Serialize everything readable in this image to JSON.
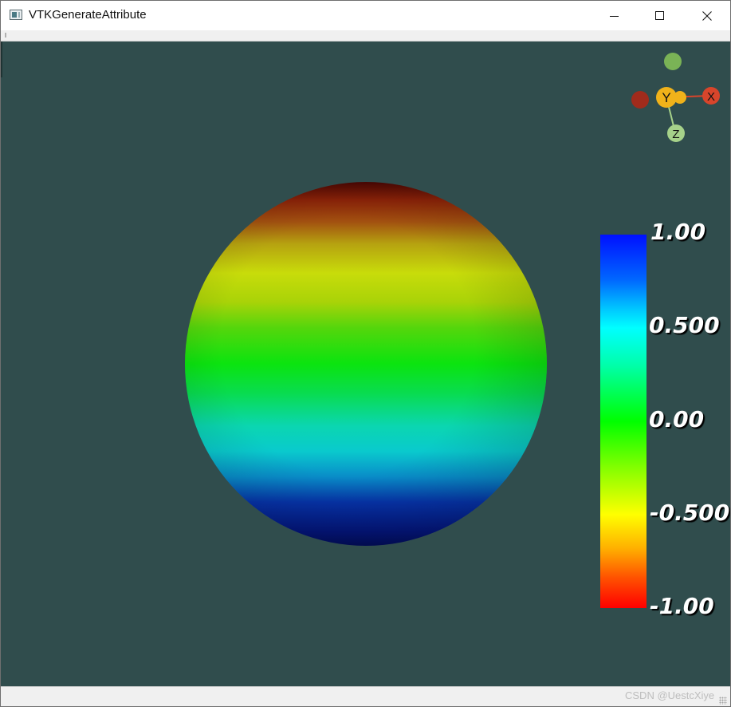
{
  "window": {
    "title": "VTKGenerateAttribute",
    "icon": "app-window-icon",
    "controls": [
      "minimize-icon",
      "maximize-icon",
      "close-icon"
    ]
  },
  "viewport": {
    "background_color": "#304d4d",
    "object": "sphere",
    "colormap": "rainbow (red to blue)"
  },
  "scalar_bar": {
    "tick_labels": [
      "1.00",
      "0.500",
      "0.00",
      "-0.500",
      "-1.00"
    ],
    "range": [
      -1.0,
      1.0
    ],
    "color_low": "#ff0000",
    "color_high": "#0010ff"
  },
  "orientation_axes": {
    "x_label": "X",
    "y_label": "Y",
    "z_label": "Z",
    "x_color": "#d8452b",
    "y_color": "#f0b21a",
    "z_color": "#a6d28a"
  },
  "statusbar": {
    "watermark": "CSDN @UestcXiye"
  }
}
